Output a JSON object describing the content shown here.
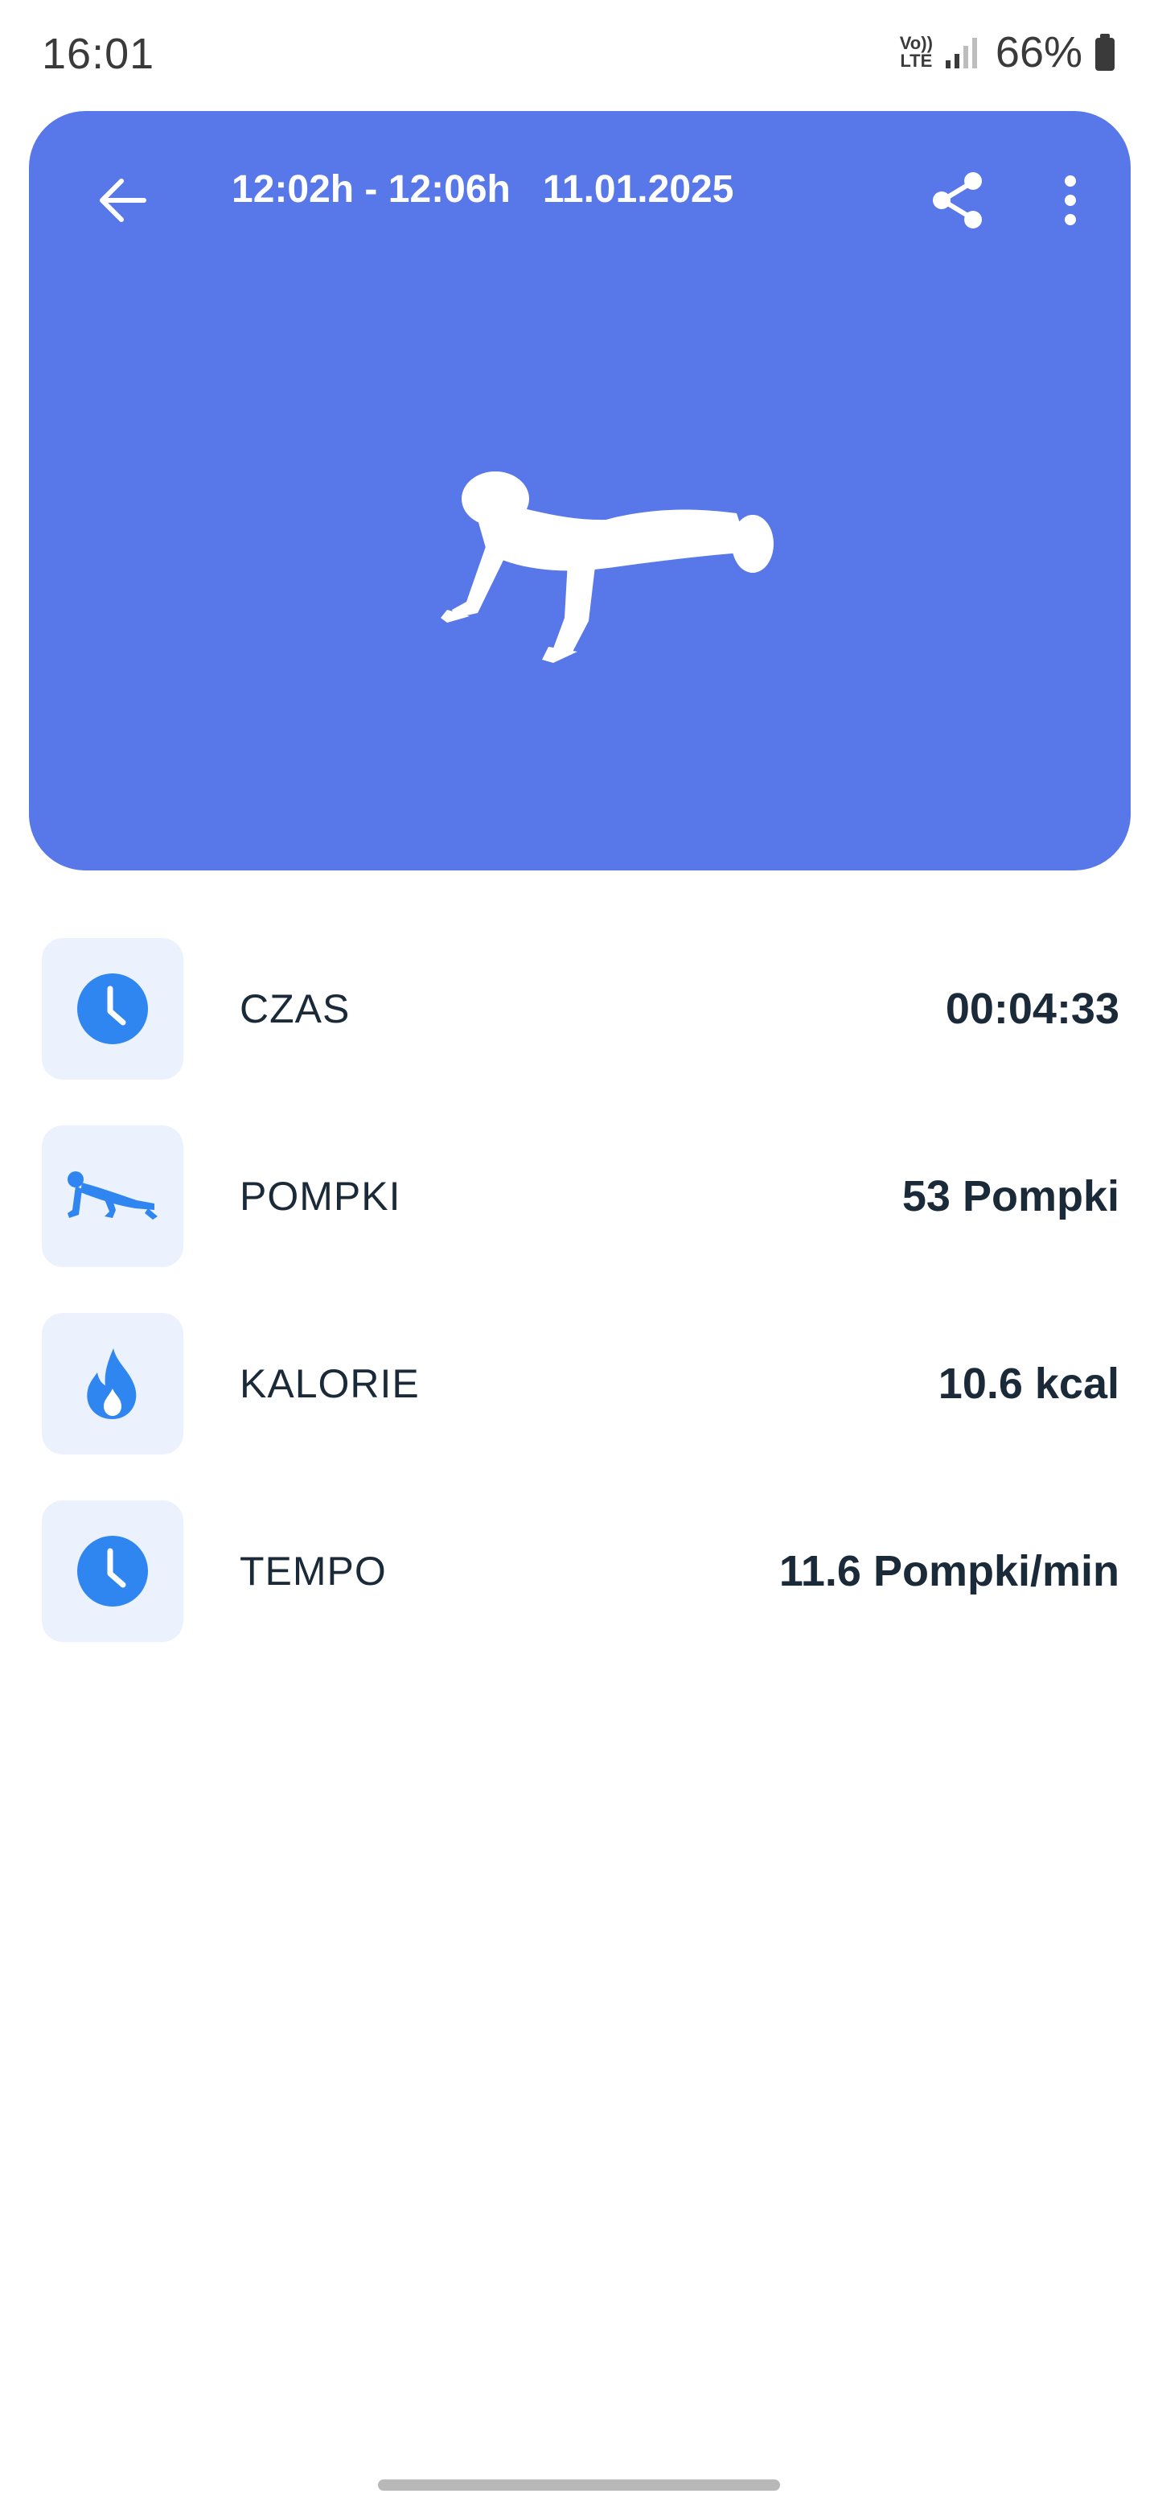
{
  "status_bar": {
    "time": "16:01",
    "volte_top": "Vo))",
    "volte_bottom": "LTE",
    "battery": "66%",
    "icons": [
      "volte-icon",
      "signal-icon",
      "battery-icon"
    ]
  },
  "header": {
    "title": "12:02h - 12:06h   11.01.2025",
    "back_icon": "arrow-left-icon",
    "share_icon": "share-icon",
    "more_icon": "more-vertical-icon",
    "hero_icon": "pushup-figure-icon",
    "accent_color": "#5877e8"
  },
  "stats": [
    {
      "label": "CZAS",
      "value": "00:04:33",
      "icon": "clock-icon"
    },
    {
      "label": "POMPKI",
      "value": "53 Pompki",
      "icon": "pushup-icon"
    },
    {
      "label": "KALORIE",
      "value": "10.6 kcal",
      "icon": "flame-icon"
    },
    {
      "label": "TEMPO",
      "value": "11.6 Pompki/min",
      "icon": "clock-icon"
    }
  ],
  "colors": {
    "icon_blue": "#2f86f0",
    "icon_bg": "#ebf2fd",
    "text_dark": "#1b2a38"
  }
}
